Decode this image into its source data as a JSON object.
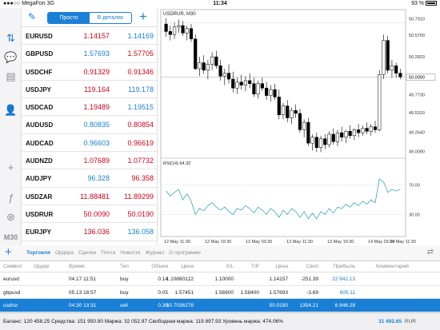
{
  "status": {
    "carrier": "●●●○○ MegaFon 3G",
    "time": "11:34",
    "battery": "93 %"
  },
  "sidebar": {
    "items": [
      {
        "name": "quotes-icon",
        "glyph": "⇅"
      },
      {
        "name": "chat-icon",
        "glyph": "💬"
      },
      {
        "name": "news-icon",
        "glyph": "▤"
      },
      {
        "name": "user-icon",
        "glyph": "👤"
      },
      {
        "name": "crosshair-icon",
        "glyph": "+"
      },
      {
        "name": "indicators-icon",
        "glyph": "ƒ"
      },
      {
        "name": "objects-icon",
        "glyph": "⊛"
      }
    ],
    "timeframe": "M30"
  },
  "quotes_header": {
    "tab_simple": "Просто",
    "tab_details": "В деталях"
  },
  "quotes": [
    {
      "symbol": "EURUSD",
      "bid": "1.14157",
      "ask": "1.14169",
      "bid_color": "red",
      "ask_color": "blue"
    },
    {
      "symbol": "GBPUSD",
      "bid": "1.57693",
      "ask": "1.57705",
      "bid_color": "blue",
      "ask_color": "red"
    },
    {
      "symbol": "USDCHF",
      "bid": "0.91329",
      "ask": "0.91346",
      "bid_color": "red",
      "ask_color": "red"
    },
    {
      "symbol": "USDJPY",
      "bid": "119.164",
      "ask": "119.178",
      "bid_color": "red",
      "ask_color": "blue"
    },
    {
      "symbol": "USDCAD",
      "bid": "1.19489",
      "ask": "1.19515",
      "bid_color": "red",
      "ask_color": "blue"
    },
    {
      "symbol": "AUDUSD",
      "bid": "0.80835",
      "ask": "0.80854",
      "bid_color": "blue",
      "ask_color": "red"
    },
    {
      "symbol": "AUDCAD",
      "bid": "0.96603",
      "ask": "0.96619",
      "bid_color": "blue",
      "ask_color": "red"
    },
    {
      "symbol": "AUDNZD",
      "bid": "1.07689",
      "ask": "1.07732",
      "bid_color": "red",
      "ask_color": "red"
    },
    {
      "symbol": "AUDJPY",
      "bid": "96.328",
      "ask": "96.358",
      "bid_color": "blue",
      "ask_color": "red"
    },
    {
      "symbol": "USDZAR",
      "bid": "11.88481",
      "ask": "11.89299",
      "bid_color": "red",
      "ask_color": "red"
    },
    {
      "symbol": "USDRUR",
      "bid": "50.0090",
      "ask": "50.0190",
      "bid_color": "red",
      "ask_color": "red"
    },
    {
      "symbol": "EURJPY",
      "bid": "136.036",
      "ask": "136.058",
      "bid_color": "red",
      "ask_color": "blue"
    }
  ],
  "chart": {
    "title": "USDRUR, M30",
    "rsi_label": "RSI(14) 64.32",
    "price_levels": [
      "50.7910",
      "50.5700",
      "50.2820",
      "50.0000",
      "49.7730",
      "49.5310",
      "49.2640",
      "49.0090"
    ],
    "current_price": "50.0090",
    "rsi_levels": [
      "70.00",
      "30.00"
    ],
    "time_labels": [
      "12 May 11:30",
      "12 May 19:30",
      "13 May 03:30",
      "13 May 11:30",
      "13 May 19:30",
      "14 May 03:30",
      "14 May 11:30"
    ],
    "colors": {
      "bull": "#ffffff",
      "bear": "#000000",
      "rsi": "#3aa3c8"
    }
  },
  "chart_data": {
    "type": "candlestick",
    "title": "USDRUR, M30",
    "ylim": [
      48.95,
      50.85
    ],
    "ohlc": [
      [
        50.72,
        50.8,
        50.55,
        50.62
      ],
      [
        50.62,
        50.7,
        50.5,
        50.58
      ],
      [
        50.58,
        50.74,
        50.52,
        50.68
      ],
      [
        50.68,
        50.78,
        50.6,
        50.7
      ],
      [
        50.7,
        50.76,
        50.56,
        50.6
      ],
      [
        50.6,
        50.7,
        50.5,
        50.66
      ],
      [
        50.66,
        50.72,
        50.48,
        50.52
      ],
      [
        50.52,
        50.58,
        50.1,
        50.12
      ],
      [
        50.12,
        50.28,
        50.02,
        50.2
      ],
      [
        50.2,
        50.3,
        50.05,
        50.1
      ],
      [
        50.1,
        50.24,
        49.98,
        50.18
      ],
      [
        50.18,
        50.34,
        50.1,
        50.28
      ],
      [
        50.28,
        50.36,
        50.12,
        50.16
      ],
      [
        50.16,
        50.24,
        49.96,
        50.02
      ],
      [
        50.02,
        50.12,
        49.9,
        50.06
      ],
      [
        50.06,
        50.18,
        49.92,
        49.98
      ],
      [
        49.98,
        50.08,
        49.8,
        49.86
      ],
      [
        49.86,
        50.0,
        49.78,
        49.94
      ],
      [
        49.94,
        50.04,
        49.84,
        49.9
      ],
      [
        49.9,
        50.02,
        49.82,
        49.96
      ],
      [
        49.96,
        50.06,
        49.86,
        49.92
      ],
      [
        49.92,
        50.0,
        49.74,
        49.78
      ],
      [
        49.78,
        49.96,
        49.72,
        49.92
      ],
      [
        49.92,
        50.0,
        49.82,
        49.86
      ],
      [
        49.86,
        49.94,
        49.7,
        49.76
      ],
      [
        49.76,
        49.9,
        49.68,
        49.84
      ],
      [
        49.84,
        49.92,
        49.7,
        49.74
      ],
      [
        49.74,
        49.84,
        49.44,
        49.5
      ],
      [
        49.5,
        49.66,
        49.44,
        49.62
      ],
      [
        49.62,
        49.7,
        49.4,
        49.46
      ],
      [
        49.46,
        49.6,
        49.38,
        49.56
      ],
      [
        49.56,
        49.64,
        49.46,
        49.52
      ],
      [
        49.52,
        49.58,
        49.26,
        49.3
      ],
      [
        49.3,
        49.44,
        49.2,
        49.4
      ],
      [
        49.4,
        49.46,
        49.08,
        49.12
      ],
      [
        49.12,
        49.24,
        49.02,
        49.2
      ],
      [
        49.2,
        49.26,
        49.0,
        49.06
      ],
      [
        49.06,
        49.22,
        49.0,
        49.18
      ],
      [
        49.18,
        49.24,
        49.04,
        49.1
      ],
      [
        49.1,
        49.28,
        49.06,
        49.24
      ],
      [
        49.24,
        49.32,
        49.1,
        49.14
      ],
      [
        49.14,
        49.3,
        49.08,
        49.26
      ],
      [
        49.26,
        49.34,
        49.14,
        49.2
      ],
      [
        49.2,
        49.3,
        49.12,
        49.28
      ],
      [
        49.28,
        49.36,
        49.18,
        49.22
      ],
      [
        49.22,
        49.32,
        49.16,
        49.3
      ],
      [
        49.3,
        49.38,
        49.2,
        49.26
      ],
      [
        49.26,
        49.36,
        49.22,
        49.32
      ],
      [
        49.32,
        49.4,
        49.24,
        49.28
      ],
      [
        49.28,
        49.38,
        49.22,
        49.34
      ],
      [
        49.34,
        49.42,
        49.26,
        49.3
      ],
      [
        49.3,
        50.1,
        49.28,
        50.04
      ],
      [
        50.04,
        50.58,
        49.98,
        50.5
      ],
      [
        50.5,
        50.56,
        50.06,
        50.1
      ],
      [
        50.1,
        50.24,
        50.0,
        50.16
      ],
      [
        50.16,
        50.2,
        50.0,
        50.06
      ],
      [
        50.06,
        50.12,
        49.98,
        50.01
      ]
    ],
    "rsi": [
      62,
      55,
      60,
      64,
      50,
      58,
      48,
      30,
      38,
      35,
      42,
      46,
      40,
      36,
      40,
      34,
      30,
      38,
      36,
      42,
      38,
      32,
      40,
      36,
      30,
      38,
      34,
      26,
      36,
      30,
      38,
      34,
      26,
      34,
      24,
      32,
      24,
      34,
      30,
      38,
      32,
      40,
      38,
      44,
      40,
      46,
      42,
      48,
      44,
      50,
      46,
      78,
      74,
      60,
      64,
      62,
      64
    ]
  },
  "bottom": {
    "tabs": [
      "Торговля",
      "Ордера",
      "Сделки",
      "Почта",
      "Новости",
      "Журнал",
      "О программе"
    ],
    "active_tab": 0,
    "columns": [
      "Символ",
      "Ордер",
      "Время",
      "Тип",
      "Объем",
      "Цена",
      "S/L",
      "T/P",
      "Цена",
      "Своп",
      "Прибыль",
      "Комментарий"
    ],
    "rows": [
      {
        "symbol": "eurusd",
        "order": "",
        "time": "04.17 11:51",
        "type": "buy",
        "volume": "0.14",
        "price": "1.10880122",
        "sl": "1.10000",
        "tp": "",
        "cur": "1.14157",
        "swap": "-251.39",
        "profit": "22 942.13",
        "comment": ""
      },
      {
        "symbol": "gbpusd",
        "order": "",
        "time": "05.13 18:57",
        "type": "buy",
        "volume": "0.05",
        "price": "1.57451",
        "sl": "1.56900",
        "tp": "1.58400",
        "cur": "1.57693",
        "swap": "-3.69",
        "profit": "605.11",
        "comment": ""
      },
      {
        "symbol": "usdrur",
        "order": "",
        "time": "04.30 13:31",
        "type": "sell",
        "volume": "0.30",
        "price": "50.7036278",
        "sl": "",
        "tp": "",
        "cur": "50.0190",
        "swap": "1354.21",
        "profit": "6 846.28",
        "comment": ""
      }
    ],
    "footer": "Баланс: 120 458.25 Средства: 151 950.90 Маржа: 32 052.97 Свободная маржа: 119 897.93 Уровень маржа: 474.06%",
    "total_profit": "31 492.65",
    "currency": "RUR"
  }
}
